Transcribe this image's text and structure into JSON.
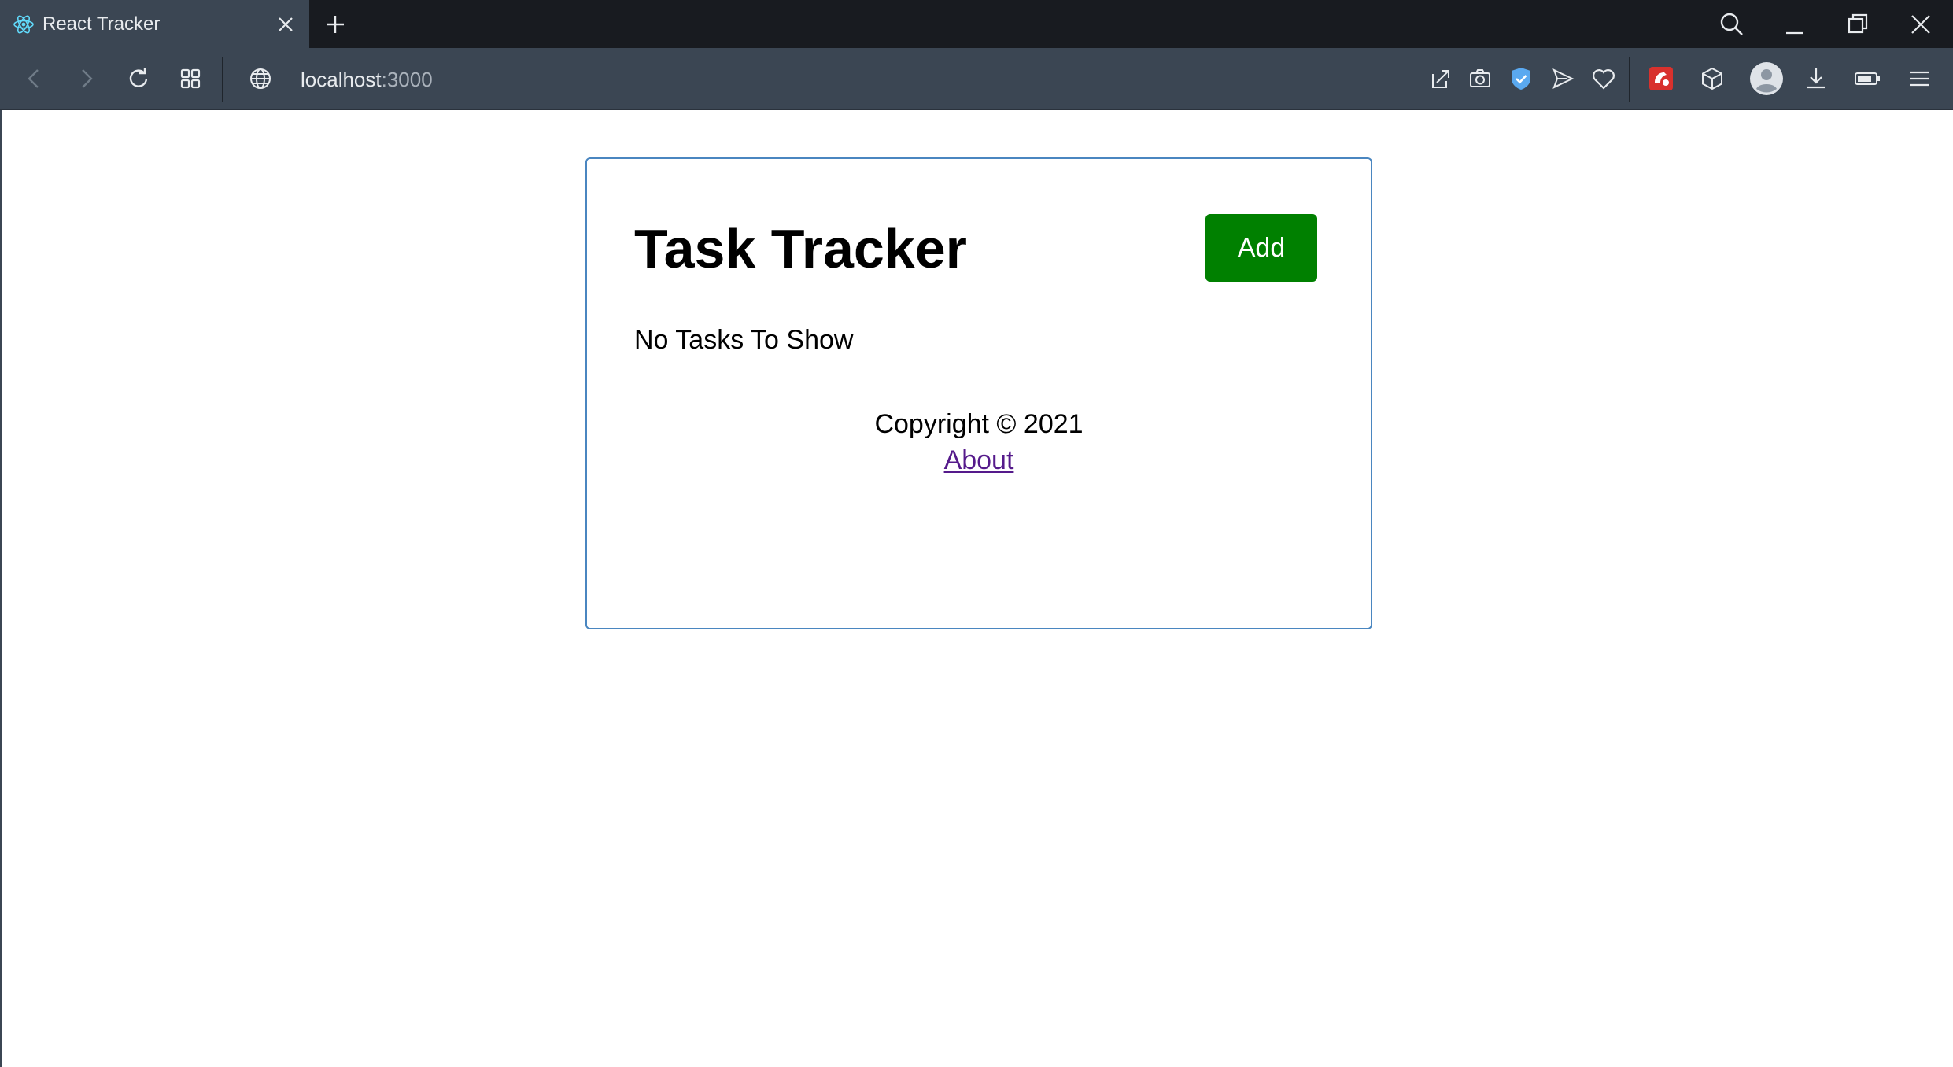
{
  "browser": {
    "tab": {
      "title": "React Tracker"
    },
    "address": {
      "host": "localhost",
      "port": ":3000"
    }
  },
  "app": {
    "header": {
      "title": "Task Tracker",
      "add_label": "Add"
    },
    "tasks": {
      "empty_message": "No Tasks To Show"
    },
    "footer": {
      "copyright": "Copyright © 2021",
      "about_label": "About"
    }
  },
  "colors": {
    "add_button": "#008000",
    "container_border": "#4a86c0",
    "link_visited": "#551a8b",
    "toolbar_bg": "#3b4653",
    "tabstrip_bg": "#181b20"
  },
  "icons": {
    "tab": [
      "react-atom-icon",
      "close-icon",
      "plus-icon"
    ],
    "window": [
      "search-icon",
      "minimize-icon",
      "restore-icon",
      "close-window-icon"
    ],
    "toolbar": [
      "back-icon",
      "forward-icon",
      "reload-icon",
      "tiles-icon",
      "globe-icon",
      "share-icon",
      "camera-icon",
      "shield-icon",
      "send-icon",
      "heart-icon",
      "extension-icon",
      "cube-icon",
      "profile-icon",
      "download-icon",
      "battery-icon",
      "menu-icon"
    ]
  }
}
